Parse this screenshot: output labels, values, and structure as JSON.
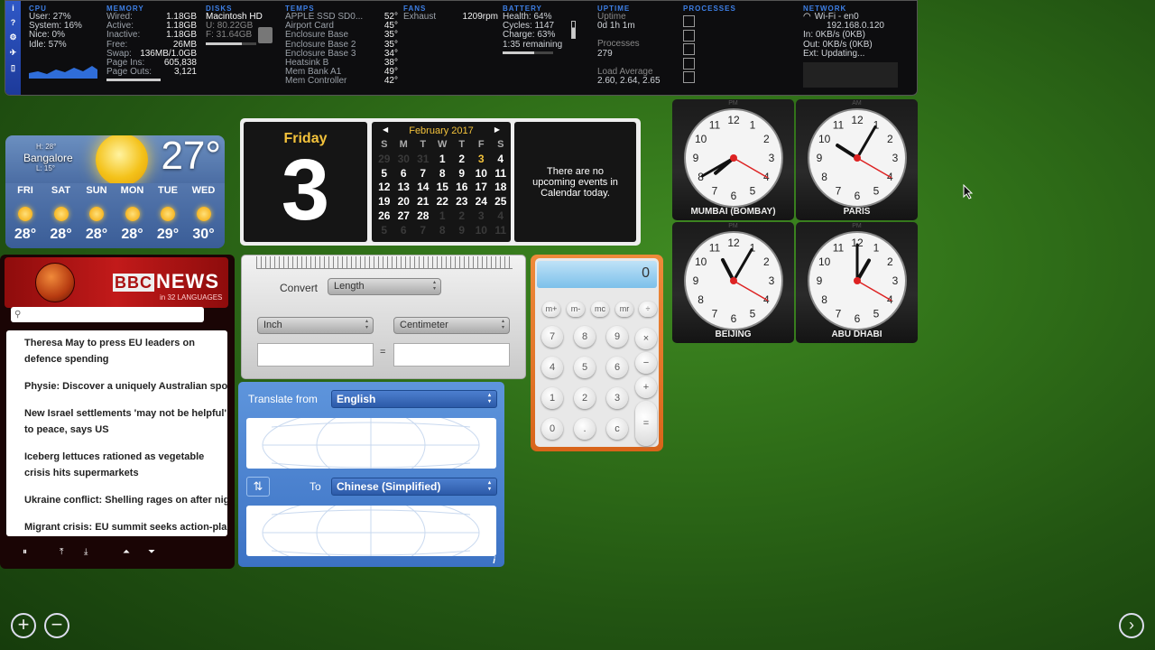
{
  "istat": {
    "cpu": {
      "title": "CPU",
      "user": "User: 27%",
      "system": "System: 16%",
      "nice": "Nice: 0%",
      "idle": "Idle: 57%"
    },
    "memory": {
      "title": "MEMORY",
      "rows": [
        [
          "Wired:",
          "1.18GB"
        ],
        [
          "Active:",
          "1.18GB"
        ],
        [
          "Inactive:",
          "1.18GB"
        ],
        [
          "Free:",
          "26MB"
        ],
        [
          "Swap:",
          "136MB/1.0GB"
        ],
        [
          "Page Ins:",
          "605,838"
        ],
        [
          "Page Outs:",
          "3,121"
        ]
      ]
    },
    "disks": {
      "title": "DISKS",
      "name": "Macintosh HD",
      "used": "U: 80.22GB",
      "free": "F: 31.64GB"
    },
    "temps": {
      "title": "TEMPS",
      "rows": [
        [
          "APPLE SSD SD0...",
          "52°"
        ],
        [
          "Airport Card",
          "45°"
        ],
        [
          "Enclosure Base",
          "35°"
        ],
        [
          "Enclosure Base 2",
          "35°"
        ],
        [
          "Enclosure Base 3",
          "34°"
        ],
        [
          "Heatsink B",
          "38°"
        ],
        [
          "Mem Bank A1",
          "49°"
        ],
        [
          "Mem Controller",
          "42°"
        ]
      ]
    },
    "fans": {
      "title": "FANS",
      "name": "Exhaust",
      "rpm": "1209rpm"
    },
    "battery": {
      "title": "BATTERY",
      "health": "Health: 64%",
      "cycles": "Cycles: 1147",
      "charge": "Charge: 63%",
      "remaining": "1:35 remaining",
      "level": 0.63
    },
    "uptime": {
      "title": "UPTIME",
      "label": "Uptime",
      "value": "0d 1h 1m",
      "proc_label": "Processes",
      "proc_value": "279",
      "load_label": "Load Average",
      "load_value": "2.60, 2.64, 2.65"
    },
    "processes": {
      "title": "PROCESSES"
    },
    "network": {
      "title": "NETWORK",
      "iface": "Wi-Fi - en0",
      "ip": "192.168.0.120",
      "in": "In: 0KB/s (0KB)",
      "out": "Out: 0KB/s (0KB)",
      "ext": "Ext: Updating..."
    }
  },
  "weather": {
    "city": "Bangalore",
    "high": "H: 28°",
    "low": "L: 15°",
    "temp": "27°",
    "days": [
      {
        "d": "FRI",
        "t": "28°"
      },
      {
        "d": "SAT",
        "t": "28°"
      },
      {
        "d": "SUN",
        "t": "28°"
      },
      {
        "d": "MON",
        "t": "28°"
      },
      {
        "d": "TUE",
        "t": "29°"
      },
      {
        "d": "WED",
        "t": "30°"
      }
    ]
  },
  "calendar": {
    "weekday": "Friday",
    "day": "3",
    "month": "February 2017",
    "headers": [
      "S",
      "M",
      "T",
      "W",
      "T",
      "F",
      "S"
    ],
    "rows": [
      [
        "29",
        "30",
        "31",
        "1",
        "2",
        "3",
        "4"
      ],
      [
        "5",
        "6",
        "7",
        "8",
        "9",
        "10",
        "11"
      ],
      [
        "12",
        "13",
        "14",
        "15",
        "16",
        "17",
        "18"
      ],
      [
        "19",
        "20",
        "21",
        "22",
        "23",
        "24",
        "25"
      ],
      [
        "26",
        "27",
        "28",
        "1",
        "2",
        "3",
        "4"
      ],
      [
        "5",
        "6",
        "7",
        "8",
        "9",
        "10",
        "11"
      ]
    ],
    "no_events": "There are no upcoming events in Calendar today."
  },
  "clocks": [
    {
      "city": "MUMBAI (BOMBAY)",
      "ampm": "PM"
    },
    {
      "city": "PARIS",
      "ampm": "AM"
    },
    {
      "city": "BEIJING",
      "ampm": "PM"
    },
    {
      "city": "ABU DHABI",
      "ampm": "PM"
    }
  ],
  "bbc": {
    "logo_a": "BBC",
    "logo_b": "NEWS",
    "sub": "in 32 LANGUAGES",
    "headlines": [
      "Theresa May to press EU leaders on defence spending",
      "Physie: Discover a uniquely Australian sport",
      "New Israel settlements 'may not be helpful' to peace, says US",
      "Iceberg lettuces rationed as vegetable crisis hits supermarkets",
      "Ukraine conflict: Shelling rages on after nigh",
      "Migrant crisis: EU summit seeks action-plan"
    ]
  },
  "converter": {
    "label": "Convert",
    "type": "Length",
    "from": "Inch",
    "to": "Centimeter",
    "eq": "="
  },
  "calculator": {
    "display": "0",
    "mem": [
      "m+",
      "m-",
      "mc",
      "mr"
    ],
    "ops": [
      "÷",
      "×",
      "−",
      "+",
      "="
    ],
    "keys": [
      "7",
      "8",
      "9",
      "4",
      "5",
      "6",
      "1",
      "2",
      "3",
      "0",
      ".",
      "c"
    ]
  },
  "translate": {
    "from_label": "Translate from",
    "from": "English",
    "to_label": "To",
    "to": "Chinese (Simplified)",
    "info": "i"
  }
}
